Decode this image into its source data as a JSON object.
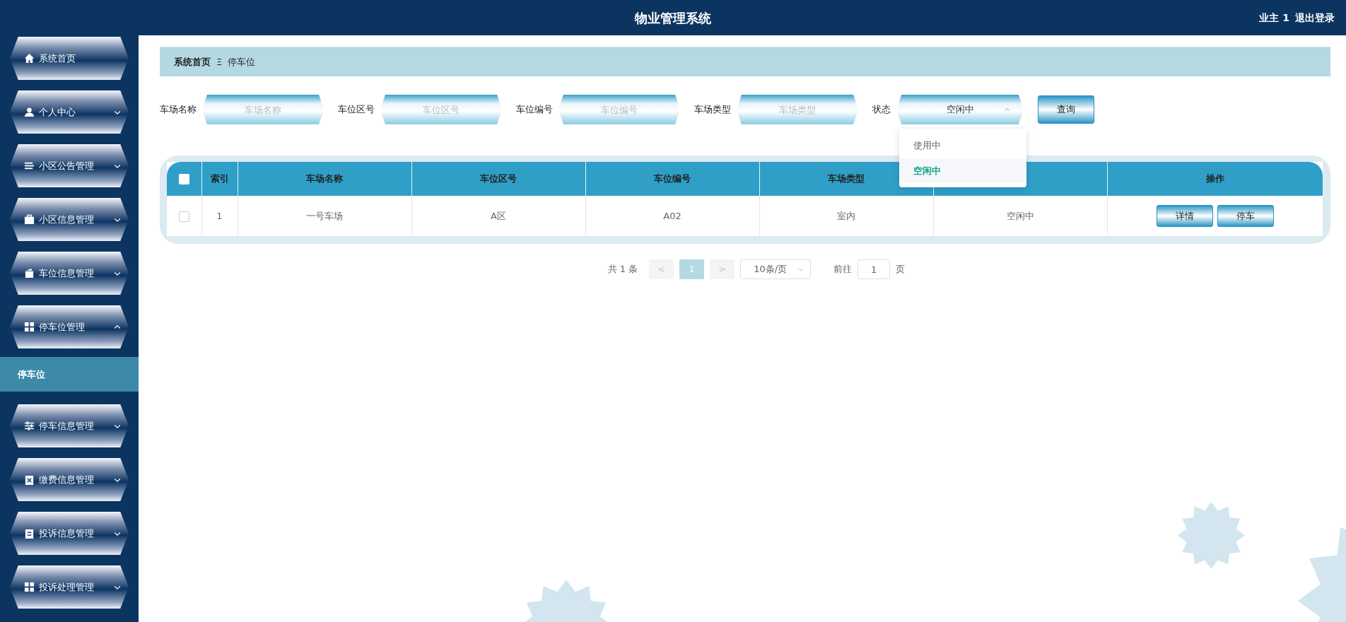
{
  "header": {
    "title": "物业管理系统",
    "user": "业主 1",
    "logout": "退出登录"
  },
  "sidebar": {
    "items": [
      {
        "label": "系统首页"
      },
      {
        "label": "个人中心",
        "expanded": false
      },
      {
        "label": "小区公告管理",
        "expanded": false
      },
      {
        "label": "小区信息管理",
        "expanded": false
      },
      {
        "label": "车位信息管理",
        "expanded": false
      },
      {
        "label": "停车位管理",
        "expanded": true,
        "children": [
          {
            "label": "停车位",
            "selected": true
          }
        ]
      },
      {
        "label": "停车信息管理",
        "expanded": false
      },
      {
        "label": "缴费信息管理",
        "expanded": false
      },
      {
        "label": "投诉信息管理",
        "expanded": false
      },
      {
        "label": "投诉处理管理",
        "expanded": false
      }
    ]
  },
  "breadcrumb": {
    "items": [
      "系统首页",
      "停车位"
    ],
    "separator": "Ξ"
  },
  "filters": [
    {
      "kind": "text",
      "label": "车场名称",
      "placeholder": "车场名称"
    },
    {
      "kind": "text",
      "label": "车位区号",
      "placeholder": "车位区号"
    },
    {
      "kind": "text",
      "label": "车位编号",
      "placeholder": "车位编号"
    },
    {
      "kind": "text",
      "label": "车场类型",
      "placeholder": "车场类型"
    },
    {
      "kind": "select",
      "label": "状态",
      "value": "空闲中",
      "expanded": true,
      "options": [
        {
          "label": "使用中",
          "selected": false
        },
        {
          "label": "空闲中",
          "selected": true
        }
      ]
    }
  ],
  "search_button": "查询",
  "table": {
    "select_all": {
      "checked": false
    },
    "columns": [
      "索引",
      "车场名称",
      "车位区号",
      "车位编号",
      "车场类型",
      "",
      "操作"
    ],
    "rows": [
      {
        "checked": false,
        "cells": [
          "1",
          "一号车场",
          "A区",
          "A02",
          "室内",
          "空闲中"
        ],
        "actions": [
          "详情",
          "停车"
        ]
      }
    ]
  },
  "pagination": {
    "total": "共 1 条",
    "prev": "<",
    "pages": [
      {
        "label": "1",
        "selected": true
      }
    ],
    "next": ">",
    "page_size": "10条/页",
    "goto_label": "前往",
    "goto_value": "1",
    "goto_suffix": "页"
  }
}
